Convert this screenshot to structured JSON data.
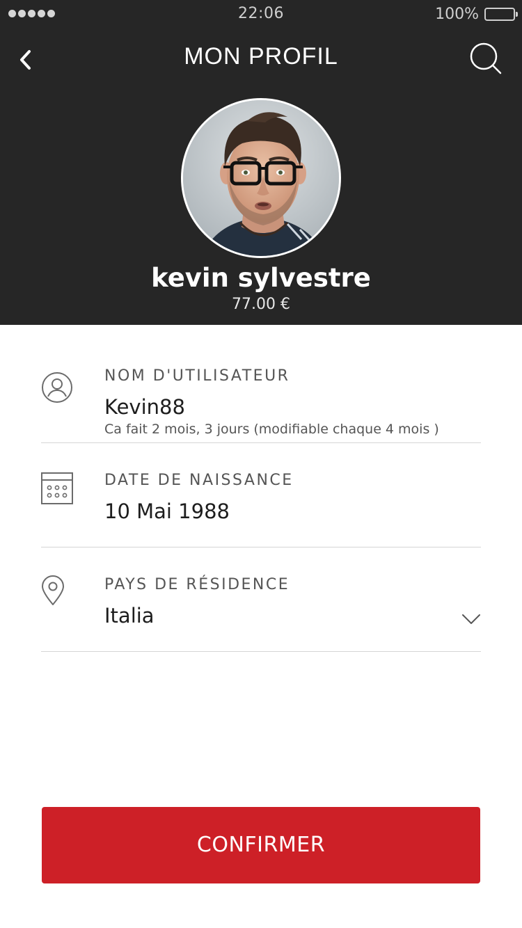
{
  "status_bar": {
    "time": "22:06",
    "battery_percent_label": "100%",
    "battery_level": 1.0,
    "signal_dots": 5
  },
  "nav": {
    "title": "MON PROFIL",
    "back_icon": "chevron-left-icon",
    "search_icon": "search-icon"
  },
  "profile": {
    "name": "kevin sylvestre",
    "balance": "77.00 €"
  },
  "fields": {
    "username": {
      "label": "NOM D'UTILISATEUR",
      "value": "Kevin88",
      "hint": "Ca fait 2 mois, 3 jours (modifiable chaque 4 mois )",
      "icon": "user-icon"
    },
    "birthdate": {
      "label": "DATE DE NAISSANCE",
      "value": "10 Mai 1988",
      "icon": "calendar-icon"
    },
    "country": {
      "label": "PAYS DE RÉSIDENCE",
      "value": "Italia",
      "icon": "location-pin-icon",
      "dropdown_icon": "chevron-down-icon"
    }
  },
  "actions": {
    "confirm_label": "CONFIRMER"
  },
  "colors": {
    "header_bg": "#262626",
    "accent": "#cd2027",
    "divider": "#d5d5d5"
  }
}
